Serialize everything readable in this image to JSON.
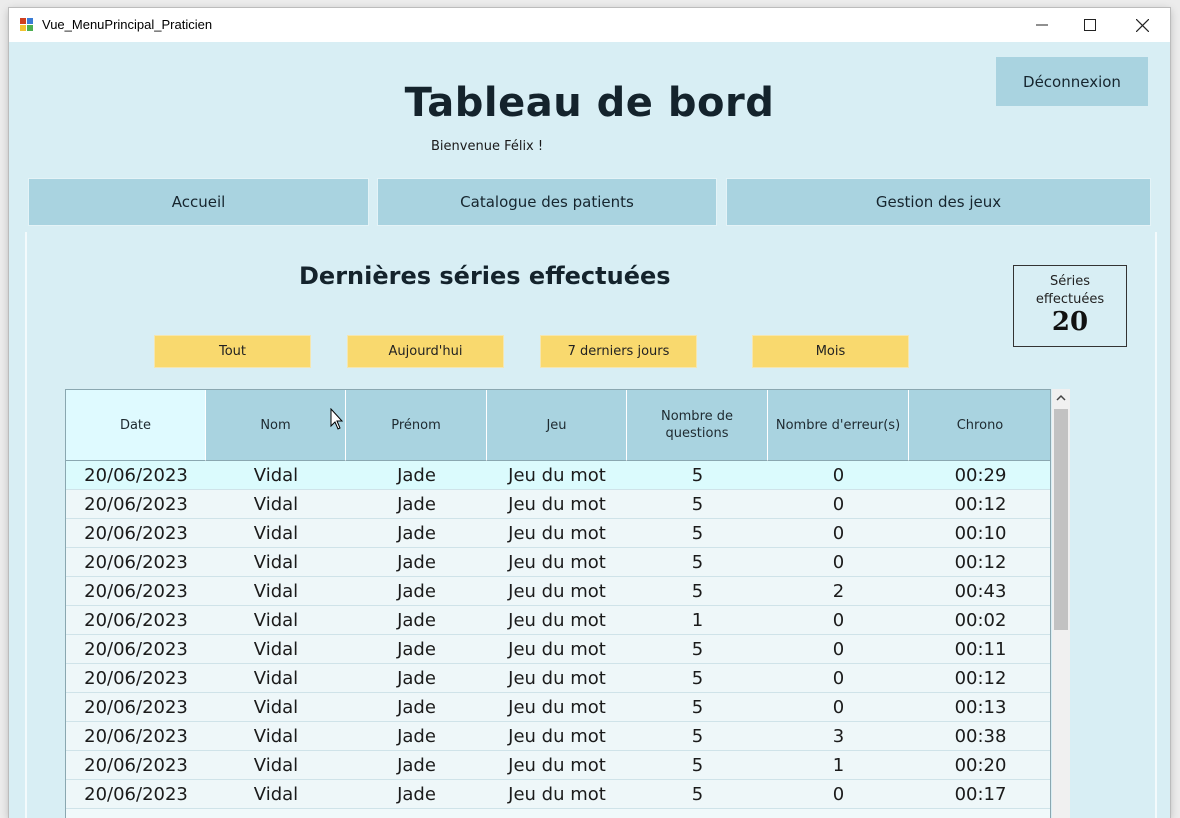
{
  "window": {
    "title": "Vue_MenuPrincipal_Praticien"
  },
  "header": {
    "title": "Tableau de bord",
    "welcome": "Bienvenue Félix !",
    "logout_label": "Déconnexion"
  },
  "nav": {
    "tabs": [
      {
        "label": "Accueil"
      },
      {
        "label": "Catalogue des patients"
      },
      {
        "label": "Gestion des jeux"
      }
    ]
  },
  "main": {
    "section_title": "Dernières séries effectuées",
    "counter": {
      "label": "Séries effectuées",
      "value": "20"
    },
    "filters": [
      "Tout",
      "Aujourd'hui",
      "7 derniers jours",
      "Mois"
    ]
  },
  "table": {
    "columns": [
      "Date",
      "Nom",
      "Prénom",
      "Jeu",
      "Nombre de questions",
      "Nombre d'erreur(s)",
      "Chrono"
    ],
    "rows": [
      [
        "20/06/2023",
        "Vidal",
        "Jade",
        "Jeu du mot",
        "5",
        "0",
        "00:29"
      ],
      [
        "20/06/2023",
        "Vidal",
        "Jade",
        "Jeu du mot",
        "5",
        "0",
        "00:12"
      ],
      [
        "20/06/2023",
        "Vidal",
        "Jade",
        "Jeu du mot",
        "5",
        "0",
        "00:10"
      ],
      [
        "20/06/2023",
        "Vidal",
        "Jade",
        "Jeu du mot",
        "5",
        "0",
        "00:12"
      ],
      [
        "20/06/2023",
        "Vidal",
        "Jade",
        "Jeu du mot",
        "5",
        "2",
        "00:43"
      ],
      [
        "20/06/2023",
        "Vidal",
        "Jade",
        "Jeu du mot",
        "1",
        "0",
        "00:02"
      ],
      [
        "20/06/2023",
        "Vidal",
        "Jade",
        "Jeu du mot",
        "5",
        "0",
        "00:11"
      ],
      [
        "20/06/2023",
        "Vidal",
        "Jade",
        "Jeu du mot",
        "5",
        "0",
        "00:12"
      ],
      [
        "20/06/2023",
        "Vidal",
        "Jade",
        "Jeu du mot",
        "5",
        "0",
        "00:13"
      ],
      [
        "20/06/2023",
        "Vidal",
        "Jade",
        "Jeu du mot",
        "5",
        "3",
        "00:38"
      ],
      [
        "20/06/2023",
        "Vidal",
        "Jade",
        "Jeu du mot",
        "5",
        "1",
        "00:20"
      ],
      [
        "20/06/2023",
        "Vidal",
        "Jade",
        "Jeu du mot",
        "5",
        "0",
        "00:17"
      ]
    ]
  },
  "icons": {
    "app": "app-icon",
    "minimize": "minimize-icon",
    "maximize": "maximize-icon",
    "close": "close-icon",
    "scroll_up": "chevron-up-icon",
    "cursor": "mouse-pointer-icon"
  },
  "colors": {
    "background": "#d8eef4",
    "nav_button": "#a9d3e0",
    "filter_button": "#f9d96e",
    "selected_row": "#dbfbfd"
  }
}
